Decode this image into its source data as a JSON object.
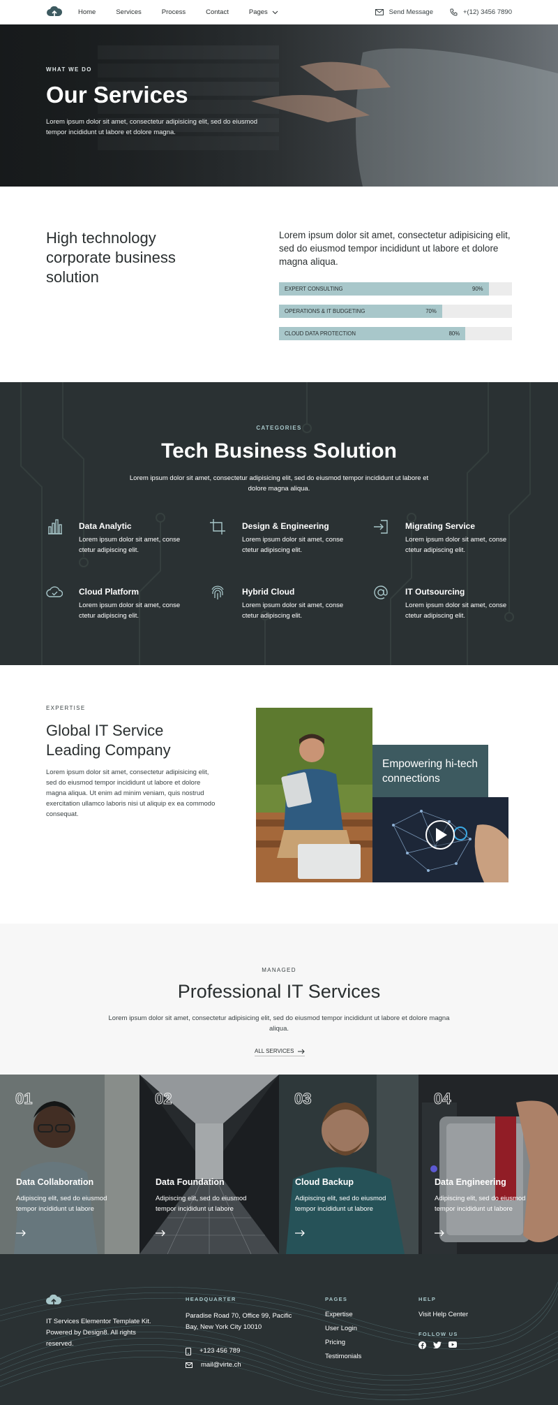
{
  "header": {
    "nav": [
      {
        "label": "Home"
      },
      {
        "label": "Services"
      },
      {
        "label": "Process"
      },
      {
        "label": "Contact"
      },
      {
        "label": "Pages"
      }
    ],
    "send_message": "Send Message",
    "phone": "+(12) 3456 7890"
  },
  "hero": {
    "eyebrow": "WHAT WE DO",
    "title": "Our Services",
    "text": "Lorem ipsum dolor sit amet, consectetur adipisicing elit, sed do eiusmod tempor incididunt ut labore et dolore magna."
  },
  "hitech": {
    "title": "High technology corporate business solution",
    "lead": "Lorem ipsum dolor sit amet, consectetur adipisicing elit, sed do eiusmod tempor incididunt ut labore et dolore magna aliqua.",
    "bars": [
      {
        "label": "EXPERT CONSULTING",
        "value_text": "90%",
        "value": 90
      },
      {
        "label": "OPERATIONS & IT BUDGETING",
        "value_text": "70%",
        "value": 70
      },
      {
        "label": "CLOUD DATA PROTECTION",
        "value_text": "80%",
        "value": 80
      }
    ]
  },
  "techbiz": {
    "eyebrow": "CATEGORIES",
    "title": "Tech Business Solution",
    "text": "Lorem ipsum dolor sit amet, consectetur adipisicing elit, sed do eiusmod tempor incididunt ut labore et dolore magna aliqua.",
    "services": [
      {
        "title": "Data Analytic",
        "text": "Lorem ipsum dolor sit amet, conse ctetur adipiscing elit.",
        "icon": "bar-chart-icon"
      },
      {
        "title": "Design & Engineering",
        "text": "Lorem ipsum dolor sit amet, conse ctetur adipiscing elit.",
        "icon": "crop-icon"
      },
      {
        "title": "Migrating Service",
        "text": "Lorem ipsum dolor sit amet, conse ctetur adipiscing elit.",
        "icon": "sign-in-icon"
      },
      {
        "title": "Cloud Platform",
        "text": "Lorem ipsum dolor sit amet, conse ctetur adipiscing elit.",
        "icon": "cloud-check-icon"
      },
      {
        "title": "Hybrid Cloud",
        "text": "Lorem ipsum dolor sit amet, conse ctetur adipiscing elit.",
        "icon": "fingerprint-icon"
      },
      {
        "title": "IT Outsourcing",
        "text": "Lorem ipsum dolor sit amet, conse ctetur adipiscing elit.",
        "icon": "at-sign-icon"
      }
    ]
  },
  "expertise": {
    "eyebrow": "EXPERTISE",
    "title": "Global IT Service Leading Company",
    "text": "Lorem ipsum dolor sit amet, consectetur adipisicing elit, sed do eiusmod tempor incididunt ut labore et dolore magna aliqua. Ut enim ad minim veniam, quis nostrud exercitation ullamco laboris nisi ut aliquip ex ea commodo consequat.",
    "box": "Empowering hi-tech connections"
  },
  "pro": {
    "eyebrow": "MANAGED",
    "title": "Professional IT Services",
    "text": "Lorem ipsum dolor sit amet, consectetur adipisicing elit, sed do eiusmod tempor incididunt ut labore et dolore magna aliqua.",
    "link": "ALL SERVICES"
  },
  "cards": [
    {
      "num": "01",
      "title": "Data Collaboration",
      "text": "Adipiscing elit, sed do eiusmod tempor incididunt ut labore"
    },
    {
      "num": "02",
      "title": "Data Foundation",
      "text": "Adipiscing elit, sed do eiusmod tempor incididunt ut labore"
    },
    {
      "num": "03",
      "title": "Cloud Backup",
      "text": "Adipiscing elit, sed do eiusmod tempor incididunt ut labore"
    },
    {
      "num": "04",
      "title": "Data Engineering",
      "text": "Adipiscing elit, sed do eiusmod tempor incididunt ut labore"
    }
  ],
  "footer": {
    "about": "IT Services Elementor Template Kit. Powered by Design8. All rights reserved.",
    "hq_title": "HEADQUARTER",
    "address": "Paradise Road 70, Office 99, Pacific Bay,  New York City 10010",
    "phone": "+123 456 789",
    "email": "mail@virte.ch",
    "pages_title": "PAGES",
    "pages": [
      "Expertise",
      "User Login",
      "Pricing",
      "Testimonials"
    ],
    "help_title": "HELP",
    "help_link": "Visit Help Center",
    "follow_title": "FOLLOW US"
  },
  "colors": {
    "dark": "#2a3133",
    "accent": "#a8c7ca",
    "box": "#3d5a60"
  }
}
